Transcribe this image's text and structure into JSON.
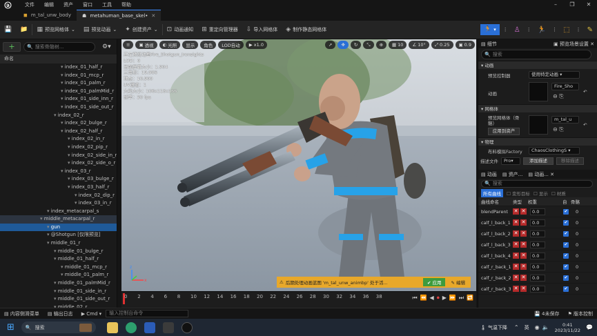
{
  "titlebar": {
    "menu": [
      "文件",
      "编辑",
      "资产",
      "窗口",
      "工具",
      "帮助"
    ]
  },
  "tabs": [
    {
      "label": "m_tal_unw_body",
      "active": false
    },
    {
      "label": "metahuman_base_skel•",
      "active": true
    }
  ],
  "toolbar": {
    "preview_mesh": "预览网格体",
    "preview_anim": "预览动画",
    "create_asset": "创建资产",
    "anim_notify": "动画通知",
    "retarget": "重定向管理器",
    "import_mesh": "导入网格体",
    "make_static": "制作静态网格体"
  },
  "left": {
    "search_placeholder": "搜索骨骼树...",
    "column": "命名",
    "rows": [
      {
        "label": "index_01_half_r",
        "indent": 10
      },
      {
        "label": "index_01_mcp_r",
        "indent": 10
      },
      {
        "label": "index_01_palm_r",
        "indent": 10
      },
      {
        "label": "index_01_palmMid_r",
        "indent": 10
      },
      {
        "label": "index_01_side_inn_r",
        "indent": 10
      },
      {
        "label": "index_01_side_out_r",
        "indent": 10
      },
      {
        "label": "index_02_r",
        "indent": 9
      },
      {
        "label": "index_02_bulge_r",
        "indent": 10
      },
      {
        "label": "index_02_half_r",
        "indent": 10
      },
      {
        "label": "index_02_in_r",
        "indent": 11
      },
      {
        "label": "index_02_pip_r",
        "indent": 11
      },
      {
        "label": "index_02_side_in_r",
        "indent": 11
      },
      {
        "label": "index_02_side_o_r",
        "indent": 11
      },
      {
        "label": "index_03_r",
        "indent": 10
      },
      {
        "label": "index_03_bulge_r",
        "indent": 11
      },
      {
        "label": "index_03_half_r",
        "indent": 11
      },
      {
        "label": "index_02_dip_r",
        "indent": 12
      },
      {
        "label": "index_03_in_r",
        "indent": 12
      },
      {
        "label": "index_metacarpal_s",
        "indent": 8
      },
      {
        "label": "middle_metacarpal_r",
        "indent": 7,
        "sel": true
      },
      {
        "label": "gun",
        "indent": 8,
        "hl": true
      },
      {
        "label": "@Shotgun [仅限预览]",
        "indent": 8
      },
      {
        "label": "middle_01_r",
        "indent": 8
      },
      {
        "label": "middle_01_bulge_r",
        "indent": 9
      },
      {
        "label": "middle_01_half_r",
        "indent": 9
      },
      {
        "label": "middle_01_mcp_r",
        "indent": 10
      },
      {
        "label": "middle_01_palm_r",
        "indent": 10
      },
      {
        "label": "middle_01_palmMid_r",
        "indent": 9
      },
      {
        "label": "middle_01_side_in_r",
        "indent": 9
      },
      {
        "label": "middle_01_side_out_r",
        "indent": 9
      },
      {
        "label": "middle_02_r",
        "indent": 9
      }
    ]
  },
  "viewport": {
    "buttons": {
      "perspective": "透视",
      "lit": "光照",
      "show": "显示",
      "character": "角色",
      "lod": "LOD自动",
      "speed": "x1.0",
      "snap_grid": "10",
      "snap_rot": "10°",
      "snap_scale": "0.25",
      "cam_speed": "0.9"
    },
    "stats": [
      "正在预览动画Fire_Shotgun_Ironsights",
      "LOD：0",
      "当前屏幕大小：1.904",
      "三角形：19,986",
      "顶点：10,900",
      "UV通道：1",
      "大约大小：106x118x166",
      "帧率：30 fps"
    ],
    "notice": "后期处理动画蓝图 'm_tal_unw_animbp' 处于活...",
    "notice_apply": "应用",
    "notice_edit": "编辑"
  },
  "timeline": {
    "ticks": [
      "0",
      "2",
      "4",
      "6",
      "8",
      "10",
      "12",
      "14",
      "16",
      "18",
      "20",
      "22",
      "24",
      "26",
      "28",
      "30",
      "32",
      "34",
      "36",
      "38"
    ]
  },
  "right": {
    "tab_details": "细节",
    "tab_preview": "预览场景设置",
    "search_placeholder": "搜索",
    "sect_anim": "动画",
    "preview_controller_label": "预览控制器",
    "preview_controller_value": "使用特定动画",
    "anim_label": "动画",
    "anim_value": "Fire_Sho",
    "sect_mesh": "网格体",
    "preview_mesh_label": "预览网格体（骨骼）",
    "preview_mesh_value": "m_tal_u",
    "apply_to_asset": "应用到资产",
    "sect_physics": "物理",
    "cloth_label": "布料模拟Factory",
    "cloth_value": "ChaosClothingS",
    "desc_file": "描述文件",
    "pro": "Pro",
    "add_desc": "添加描述",
    "remove_desc": "移除描述",
    "tab_anim": "动画",
    "tab_asset": "资产...",
    "tab_anim2": "动画...",
    "search2_placeholder": "搜索",
    "filter_all": "所有曲线",
    "filter_morph": "变形目标",
    "filter_show": "显示",
    "filter_material": "材质",
    "col_name": "曲线命名",
    "col_type": "类型",
    "col_weight": "权重",
    "col_auto": "自",
    "col_bone": "骨骼",
    "curves": [
      {
        "name": "blendParent",
        "value": "0.0",
        "bone": "0"
      },
      {
        "name": "calf_l_back_1",
        "value": "0.0",
        "bone": "0"
      },
      {
        "name": "calf_l_back_2",
        "value": "0.0",
        "bone": "0"
      },
      {
        "name": "calf_l_back_3",
        "value": "0.0",
        "bone": "0"
      },
      {
        "name": "calf_l_back_4",
        "value": "0.0",
        "bone": "0"
      },
      {
        "name": "calf_r_back_1",
        "value": "0.0",
        "bone": "0"
      },
      {
        "name": "calf_r_back_2",
        "value": "0.0",
        "bone": "0"
      },
      {
        "name": "calf_r_back_3",
        "value": "0.0",
        "bone": "0"
      }
    ]
  },
  "status": {
    "content_drawer": "内容侧滑菜单",
    "output_log": "输出日志",
    "cmd": "Cmd",
    "cmd_placeholder": "输入控制台命令",
    "unsaved": "4未保存",
    "version": "版本控制"
  },
  "taskbar": {
    "search": "搜索",
    "weather": "气温下降",
    "ime": "英",
    "time": "0:41",
    "date": "2023/11/22"
  }
}
